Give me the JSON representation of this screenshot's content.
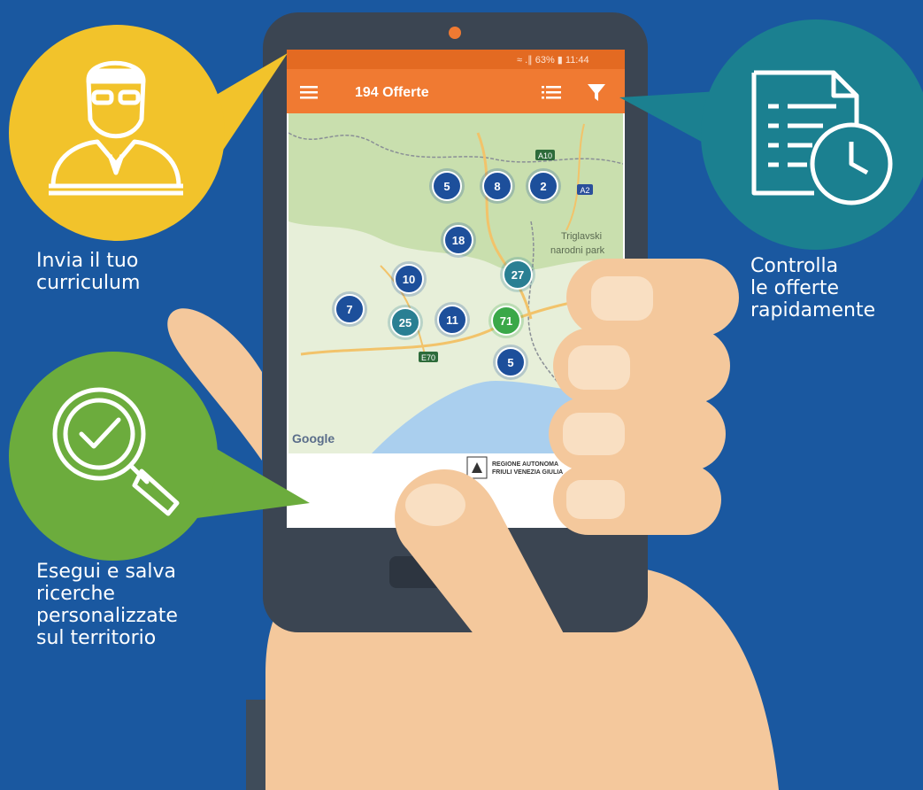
{
  "status_bar": {
    "text": "≈ .∥ 63% ▮ 11:44"
  },
  "app_bar": {
    "title": "194 Offerte",
    "menu_icon": "hamburger-menu-icon",
    "list_icon": "list-view-icon",
    "filter_icon": "filter-funnel-icon"
  },
  "map": {
    "clusters": [
      {
        "count": "5",
        "color": "#1d4f9b"
      },
      {
        "count": "8",
        "color": "#1d4f9b"
      },
      {
        "count": "2",
        "color": "#1d4f9b"
      },
      {
        "count": "18",
        "color": "#1d4f9b"
      },
      {
        "count": "27",
        "color": "#2a7f93"
      },
      {
        "count": "10",
        "color": "#1d4f9b"
      },
      {
        "count": "7",
        "color": "#1d4f9b"
      },
      {
        "count": "25",
        "color": "#2a7f93"
      },
      {
        "count": "11",
        "color": "#1d4f9b"
      },
      {
        "count": "71",
        "color": "#3aa848"
      },
      {
        "count": "5",
        "color": "#1d4f9b"
      }
    ],
    "labels": {
      "park": "Triglavski\nnarodni park",
      "road_a10": "A10",
      "road_a2": "A2",
      "road_e70": "E70",
      "google": "Google"
    }
  },
  "footer_logo": {
    "text": "REGIONE AUTONOMA\nFRIULI VENEZIA GIULIA"
  },
  "features": [
    {
      "caption": "Invia il tuo\ncurriculum",
      "icon": "person-reading-icon",
      "color": "#f2c32b"
    },
    {
      "caption": "Controlla\nle offerte\nrapidamente",
      "icon": "document-clock-icon",
      "color": "#1b8090"
    },
    {
      "caption": "Esegui e salva\nricerche\npersonalizzate\nsul territorio",
      "icon": "magnifier-check-icon",
      "color": "#6cac3d"
    }
  ],
  "colors": {
    "background": "#1a58a0",
    "app_bar": "#f07a32",
    "phone_body": "#3b4552",
    "skin": "#f4c89c",
    "sleeve": "#3f4c5a"
  }
}
